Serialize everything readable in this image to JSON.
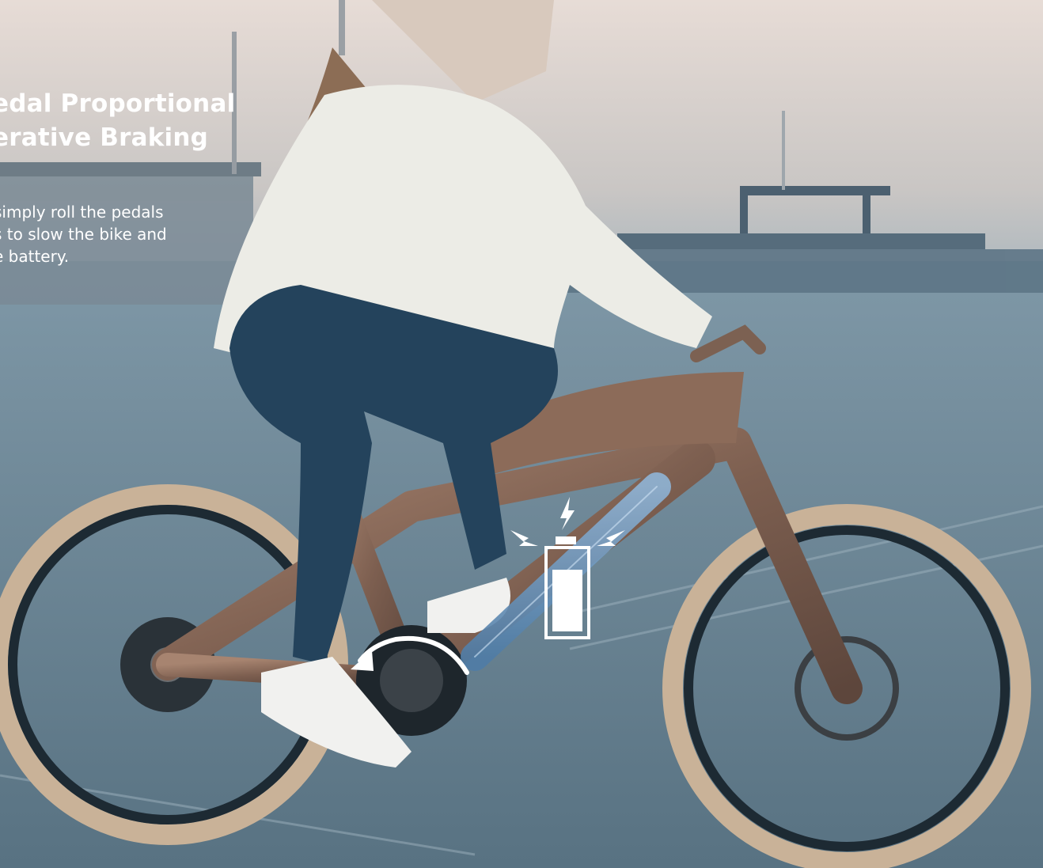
{
  "hero": {
    "title_lines": [
      "edal Proportional",
      "erative Braking"
    ],
    "body_lines": [
      "simply roll the pedals",
      "s to slow the bike and",
      "e battery."
    ]
  },
  "scene": {
    "sky_color": "#d9d2cc",
    "ground_color": "#6b8596",
    "bike_frame_color": "#8a6a58",
    "tire_color": "#cdb79c",
    "battery_tube_color": "#6a95bf",
    "overlay_icon_color": "#ffffff",
    "icons": [
      "battery-icon",
      "lightning-bolt-icon",
      "curved-arrow-icon"
    ]
  }
}
